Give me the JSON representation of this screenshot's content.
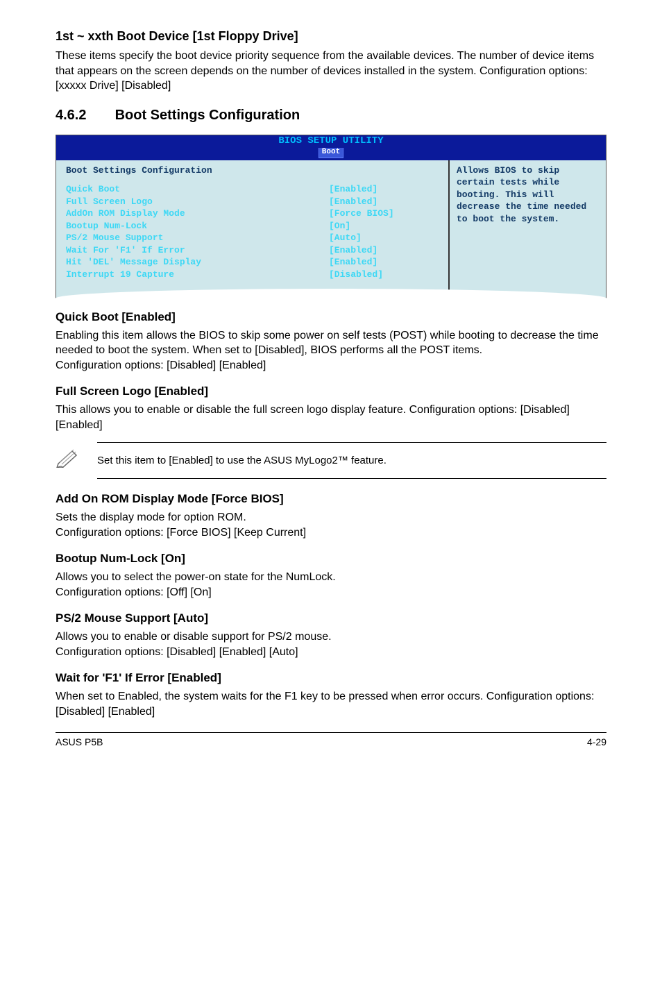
{
  "s1": {
    "title": "1st ~ xxth Boot Device [1st Floppy Drive]",
    "body": "These items specify the boot device priority sequence from the available devices. The number of device items that appears on the screen depends on the number of devices installed in the system. Configuration options: [xxxxx Drive] [Disabled]"
  },
  "sec_num": "4.6.2",
  "sec_title": "Boot Settings Configuration",
  "bios": {
    "header": "BIOS SETUP UTILITY",
    "tab": "Boot",
    "title": "Boot Settings Configuration",
    "rows": [
      {
        "label": "Quick Boot",
        "value": "[Enabled]"
      },
      {
        "label": "Full Screen Logo",
        "value": "[Enabled]"
      },
      {
        "label": "AddOn ROM Display Mode",
        "value": "[Force BIOS]"
      },
      {
        "label": "Bootup Num-Lock",
        "value": "[On]"
      },
      {
        "label": "PS/2 Mouse Support",
        "value": "[Auto]"
      },
      {
        "label": "Wait For 'F1' If Error",
        "value": "[Enabled]"
      },
      {
        "label": "Hit 'DEL' Message Display",
        "value": "[Enabled]"
      },
      {
        "label": "Interrupt 19 Capture",
        "value": "[Disabled]"
      }
    ],
    "help": "Allows BIOS to skip certain tests while booting. This will decrease the time needed to boot the system."
  },
  "quickboot": {
    "title": "Quick Boot [Enabled]",
    "p1": "Enabling this item allows the BIOS to skip some power on self tests (POST) while booting to decrease the time needed to boot the system. When set to [Disabled], BIOS performs all the POST items.",
    "p2": "Configuration options: [Disabled] [Enabled]"
  },
  "fslogo": {
    "title": "Full Screen Logo [Enabled]",
    "p1": "This allows you to enable or disable the full screen logo display feature. Configuration options: [Disabled] [Enabled]"
  },
  "note": "Set this item to [Enabled] to use the ASUS MyLogo2™ feature.",
  "addon": {
    "title": "Add On ROM Display Mode [Force BIOS]",
    "p1": "Sets the display mode for option ROM.",
    "p2": "Configuration options: [Force BIOS] [Keep Current]"
  },
  "numlock": {
    "title": "Bootup Num-Lock [On]",
    "p1": "Allows you to select the power-on state for the NumLock.",
    "p2": "Configuration options: [Off] [On]"
  },
  "ps2": {
    "title": "PS/2 Mouse Support [Auto]",
    "p1": "Allows you to enable or disable support for PS/2 mouse.",
    "p2": "Configuration options: [Disabled] [Enabled] [Auto]"
  },
  "waitf1": {
    "title": "Wait for 'F1' If Error [Enabled]",
    "p1": "When set to Enabled, the system waits for the F1 key to be pressed when error occurs. Configuration options: [Disabled] [Enabled]"
  },
  "footer": {
    "left": "ASUS P5B",
    "right": "4-29"
  }
}
